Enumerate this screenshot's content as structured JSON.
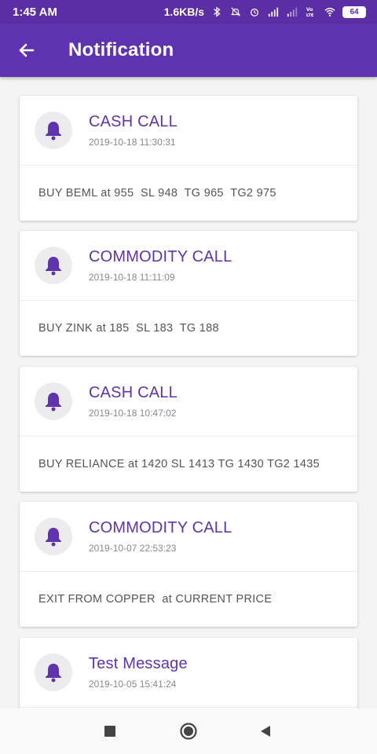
{
  "status_bar": {
    "time": "1:45 AM",
    "speed": "1.6KB/s",
    "battery": "64",
    "icons": [
      "bluetooth-icon",
      "mute-icon",
      "alarm-icon",
      "signal-icon",
      "signal-icon",
      "volte-icon",
      "wifi-icon",
      "battery-icon"
    ]
  },
  "app_bar": {
    "title": "Notification",
    "back_icon": "back-arrow-icon"
  },
  "colors": {
    "primary": "#5f33b0",
    "status_bar": "#5b2ea6"
  },
  "notifications": [
    {
      "title": "CASH CALL",
      "time": "2019-10-18 11:30:31",
      "message": "BUY BEML at 955  SL 948  TG 965  TG2 975",
      "icon": "bell-icon"
    },
    {
      "title": "COMMODITY CALL",
      "time": "2019-10-18 11:11:09",
      "message": "BUY ZINK at 185  SL 183  TG 188",
      "icon": "bell-icon"
    },
    {
      "title": "CASH CALL",
      "time": "2019-10-18 10:47:02",
      "message": "BUY RELIANCE at 1420 SL 1413 TG 1430 TG2 1435",
      "icon": "bell-icon"
    },
    {
      "title": "COMMODITY CALL",
      "time": "2019-10-07 22:53:23",
      "message": "EXIT FROM COPPER  at CURRENT PRICE",
      "icon": "bell-icon"
    },
    {
      "title": "Test Message",
      "time": "2019-10-05 15:41:24",
      "message": "",
      "icon": "bell-icon"
    }
  ],
  "nav_bar": {
    "buttons": [
      "recents-square-icon",
      "home-circle-icon",
      "back-triangle-icon"
    ]
  }
}
